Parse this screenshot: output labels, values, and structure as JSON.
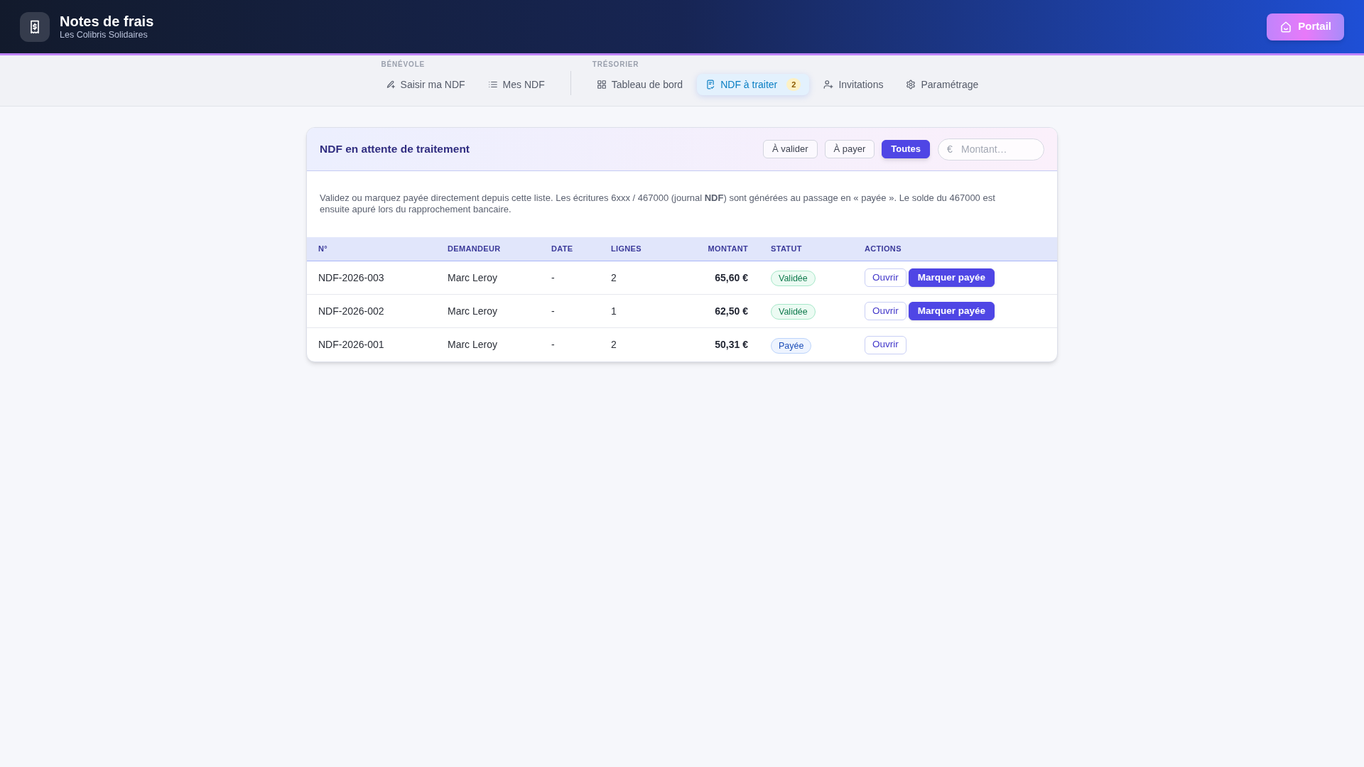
{
  "header": {
    "title": "Notes de frais",
    "subtitle": "Les Colibris Solidaires",
    "portal_button": "Portail"
  },
  "nav": {
    "groups": [
      {
        "label": "BÉNÉVOLE",
        "items": [
          {
            "label": "Saisir ma NDF",
            "selected": false
          },
          {
            "label": "Mes NDF",
            "selected": false
          }
        ]
      },
      {
        "label": "TRÉSORIER",
        "items": [
          {
            "label": "Tableau de bord",
            "selected": false
          },
          {
            "label": "NDF à traiter",
            "selected": true,
            "badge": "2"
          },
          {
            "label": "Invitations",
            "selected": false
          },
          {
            "label": "Paramétrage",
            "selected": false
          }
        ]
      }
    ]
  },
  "panel": {
    "title": "NDF en attente de traitement",
    "filters": [
      {
        "label": "À valider",
        "selected": false
      },
      {
        "label": "À payer",
        "selected": false
      },
      {
        "label": "Toutes",
        "selected": true
      }
    ],
    "amount_field": {
      "prefix": "€",
      "placeholder": "Montant…"
    },
    "description": "Validez ou marquez payée directement depuis cette liste. Les écritures 6xxx / 467000 (journal **NDF**) sont générées au passage en « payée ». Le solde du 467000 est ensuite apuré lors du rapprochement bancaire.",
    "table": {
      "columns": [
        "N°",
        "DEMANDEUR",
        "DATE",
        "LIGNES",
        "MONTANT",
        "STATUT",
        "ACTIONS"
      ],
      "rows": [
        {
          "number": "NDF-2026-003",
          "requester": "Marc Leroy",
          "date": "-",
          "lines": "2",
          "amount": "65,60 €",
          "status": {
            "label": "Validée",
            "kind": "validated"
          },
          "actions": [
            {
              "label": "Ouvrir",
              "kind": "outline"
            },
            {
              "label": "Marquer payée",
              "kind": "primary"
            }
          ]
        },
        {
          "number": "NDF-2026-002",
          "requester": "Marc Leroy",
          "date": "-",
          "lines": "1",
          "amount": "62,50 €",
          "status": {
            "label": "Validée",
            "kind": "validated"
          },
          "actions": [
            {
              "label": "Ouvrir",
              "kind": "outline"
            },
            {
              "label": "Marquer payée",
              "kind": "primary"
            }
          ]
        },
        {
          "number": "NDF-2026-001",
          "requester": "Marc Leroy",
          "date": "-",
          "lines": "2",
          "amount": "50,31 €",
          "status": {
            "label": "Payée",
            "kind": "paid"
          },
          "actions": [
            {
              "label": "Ouvrir",
              "kind": "outline"
            }
          ]
        }
      ]
    }
  }
}
